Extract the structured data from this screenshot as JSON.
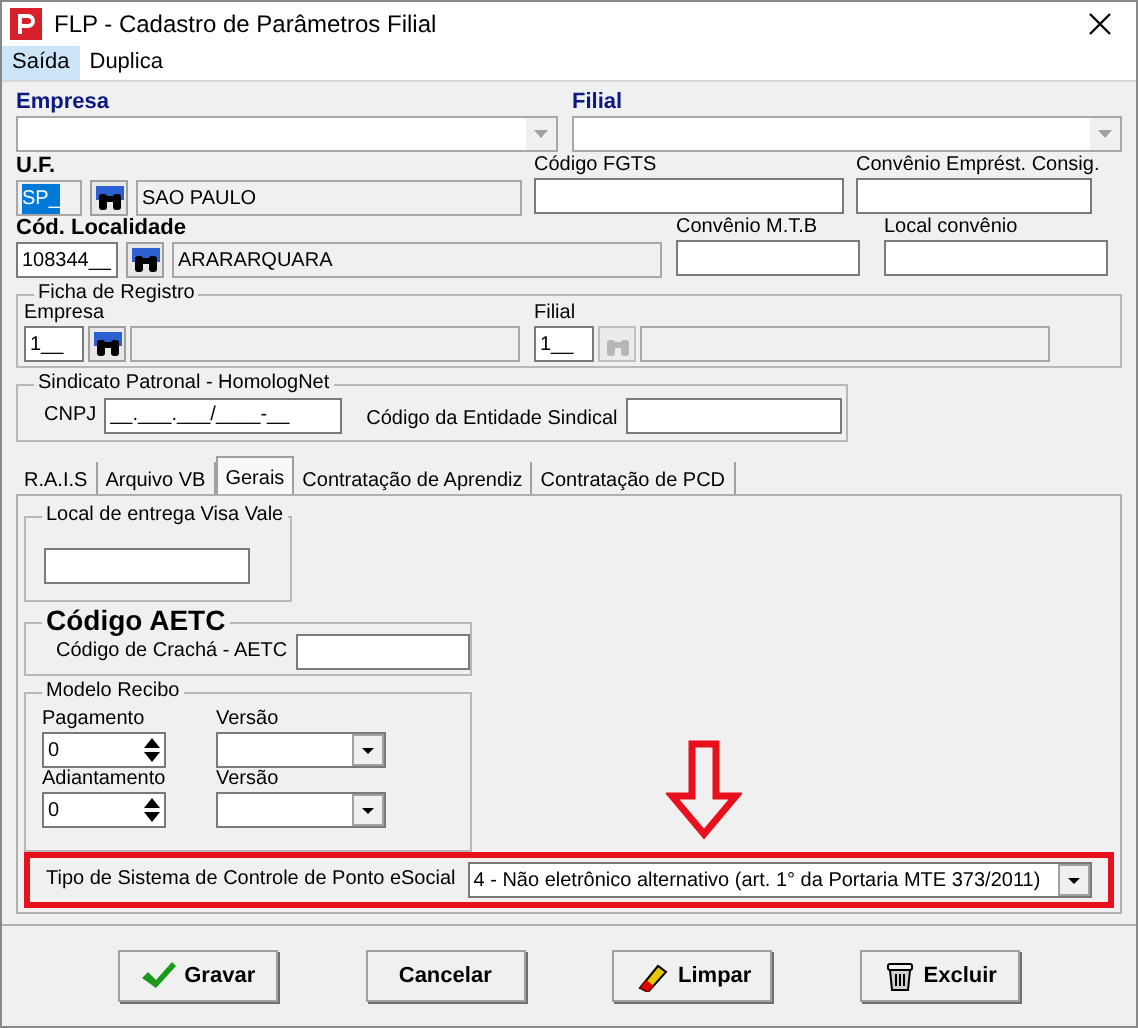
{
  "window": {
    "title": "FLP - Cadastro de Parâmetros Filial"
  },
  "menu": [
    {
      "label": "Saída",
      "selected": true
    },
    {
      "label": "Duplica",
      "selected": false
    }
  ],
  "empresa": {
    "label": "Empresa"
  },
  "filial": {
    "label": "Filial"
  },
  "uf": {
    "label": "U.F.",
    "code": "SP_",
    "code_selected": true,
    "name": "SAO PAULO"
  },
  "codigo_fgts": {
    "label": "Código FGTS"
  },
  "convenio_emprest": {
    "label": "Convênio Emprést. Consig."
  },
  "localidade": {
    "label": "Cód. Localidade",
    "code": "108344__",
    "code_selected": false,
    "name": "ARARARQUARA"
  },
  "convenio_mtb": {
    "label": "Convênio M.T.B"
  },
  "local_convenio": {
    "label": "Local convênio"
  },
  "ficha": {
    "title": "Ficha de Registro",
    "empresa": {
      "label": "Empresa",
      "value": "1__",
      "disabled": false
    },
    "filial": {
      "label": "Filial",
      "value": "1__",
      "disabled": true
    }
  },
  "sindicato": {
    "title": "Sindicato Patronal -  HomologNet",
    "cnpj_label": "CNPJ",
    "cnpj_value": "__.___.___/____-__",
    "entidade_label": "Código da Entidade Sindical"
  },
  "tabs": [
    {
      "label": "R.A.I.S",
      "selected": false
    },
    {
      "label": "Arquivo VB",
      "selected": false
    },
    {
      "label": "Gerais",
      "selected": true
    },
    {
      "label": "Contratação de Aprendiz",
      "selected": false
    },
    {
      "label": "Contratação de PCD",
      "selected": false
    }
  ],
  "gerais": {
    "visa_title": "Local de entrega Visa Vale",
    "aetc_title": "Código AETC",
    "aetc_label": "Código de Crachá - AETC",
    "recibo_title": "Modelo Recibo",
    "recibo_rows": [
      {
        "label": "Pagamento",
        "value": "0",
        "versao_label": "Versão"
      },
      {
        "label": "Adiantamento",
        "value": "0",
        "versao_label": "Versão"
      }
    ],
    "esocial_label": "Tipo de Sistema de Controle de Ponto eSocial",
    "esocial_value": "4 - Não eletrônico alternativo (art. 1° da Portaria MTE 373/2011)",
    "highlighted": true
  },
  "buttons": [
    {
      "label": "Gravar",
      "kind": "check"
    },
    {
      "label": "Cancelar",
      "kind": "plain"
    },
    {
      "label": "Limpar",
      "kind": "eraser"
    },
    {
      "label": "Excluir",
      "kind": "trash"
    }
  ]
}
